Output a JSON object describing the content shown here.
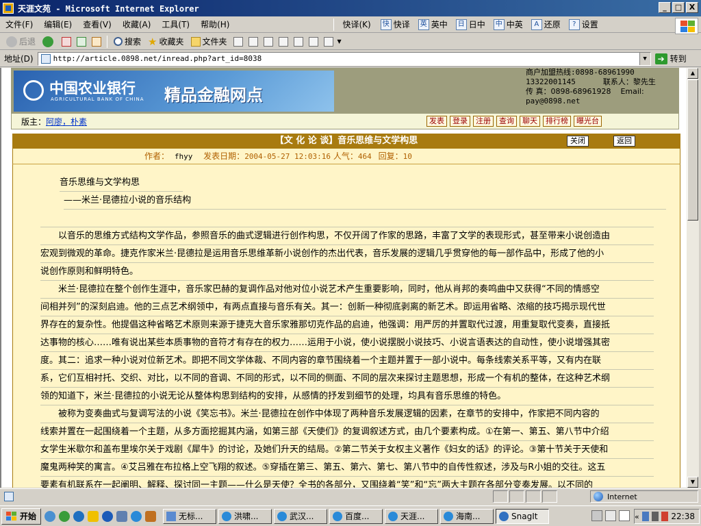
{
  "window": {
    "title": "天涯文苑 - Microsoft Internet Explorer",
    "buttons": {
      "minimize": "_",
      "maximize": "□",
      "close": "X"
    }
  },
  "menu": {
    "items": [
      "文件(F)",
      "编辑(E)",
      "查看(V)",
      "收藏(A)",
      "工具(T)",
      "帮助(H)"
    ],
    "quick_label": "快译(K)",
    "quick_items": [
      {
        "icon": "快",
        "label": "快译"
      },
      {
        "icon": "英",
        "label": "英中"
      },
      {
        "icon": "日",
        "label": "日中"
      },
      {
        "icon": "中",
        "label": "中英"
      },
      {
        "icon": "A",
        "label": "还原"
      },
      {
        "icon": "?",
        "label": "设置"
      }
    ]
  },
  "toolbar": {
    "back": "后退",
    "search": "搜索",
    "favorites": "收藏夹",
    "folders": "文件夹"
  },
  "address": {
    "label": "地址(D)",
    "url": "http://article.0898.net/inread.php?art_id=8038",
    "go": "转到"
  },
  "page": {
    "banner": {
      "bank_cn": "中国农业银行",
      "bank_en": "AGRICULTURAL BANK OF CHINA",
      "slogan": "精品金融网点"
    },
    "contact": {
      "hotline": "商户加盟热线:0898-68961990",
      "phone": "13322001145",
      "contact_person": "联系人：黎先生",
      "fax": "传  真：0898-68961928",
      "email_label": "Email:",
      "email": "pay@0898.net"
    },
    "nav": {
      "moderator_label": "版主：",
      "moderators": "阿廖，朴素",
      "buttons": [
        "发表",
        "登录",
        "注册",
        "查询",
        "聊天",
        "排行榜",
        "曝光台"
      ]
    },
    "article": {
      "title": "【文 化 论 谈】音乐思维与文学构思",
      "close_btn": "关闭",
      "back_btn": "返回",
      "author_label": "作者：",
      "author": "fhyy",
      "date_label": "发表日期：",
      "date": "2004-05-27 12:03:16",
      "views_label": "人气：",
      "views": "464",
      "replies_label": "回复：",
      "replies": "10",
      "lines": [
        "音乐思维与文学构思",
        "——米兰·昆德拉小说的音乐结构",
        "",
        "以音乐的思维方式结构文学作品，参照音乐的曲式逻辑进行创作构思，不仅开阔了作家的思路，丰富了文学的表现形式，甚至带来小说创造由",
        "宏观到微观的革命。捷克作家米兰·昆德拉是运用音乐思维革新小说创作的杰出代表，音乐发展的逻辑几乎贯穿他的每一部作品中，形成了他的小",
        "说创作原则和鲜明特色。",
        "米兰·昆德拉在整个创作生涯中，音乐家巴赫的复调作品对他对位小说艺术产生重要影响，同时，他从肖邦的奏鸣曲中又获得“不同的情感空",
        "间相并列”的深刻启迪。他的三点艺术纲领中，有两点直接与音乐有关。其一：创新一种彻底剥离的新艺术。即运用省略、浓缩的技巧揭示现代世",
        "界存在的复杂性。他提倡这种省略艺术原则来源于捷克大音乐家雅那切克作品的启迪，他强调：用严厉的并置取代过渡，用重复取代变奏，直接抵",
        "达事物的核心……唯有说出某些本质事物的音符才有存在的权力……运用于小说，使小说摆脱小说技巧、小说言语表达的自动性，使小说增强其密",
        "度。其二：追求一种小说对位新艺术。即把不同文学体裁、不同内容的章节围绕着一个主题并置于一部小说中。每条线索关系平等，又有内在联",
        "系，它们互相衬托、交织、对比，以不同的音调、不同的形式，以不同的侧面、不同的层次来探讨主题思想，形成一个有机的整体，在这种艺术纲",
        "领的知道下，米兰·昆德拉的小说无论从整体构思到结构的安排，从感情的抒发到细节的处理，均具有音乐思维的特色。",
        "被称为变奏曲式与复调写法的小说《笑忘书》。米兰·昆德拉在创作中体现了两种音乐发展逻辑的因素，在章节的安排中，作家把不同内容的",
        "线索并置在一起围绕着一个主题，从多方面挖掘其内涵，如第三部《天使们》的复调叙述方式，由几个要素构成。①在第一、第五、第八节中介绍",
        "女学生米歇尔和盖布里埃尔关于戏剧《犀牛》的讨论，及她们升天的结局。②第二节关于女权主义著作《妇女的话》的评论。③第十节关于天使和",
        "魔鬼两种笑的寓言。④艾吕雅在布拉格上空飞翔的叙述。⑤穿插在第三、第五、第六、第七、第八节中的自传性叙述，涉及与R小姐的交往。这五",
        "要素有机联系在一起阐明、解释、探讨同一主题——什么是天使？全书的各部分，又围绕着“笑”和“忘”两大主题在各部分变奏发展。以不同的"
      ]
    }
  },
  "statusbar": {
    "zone": "Internet"
  },
  "taskbar": {
    "start": "开始",
    "tasks": [
      "无标...",
      "洪啸...",
      "武汉...",
      "百度...",
      "天涯...",
      "海南...",
      "SnagIt"
    ],
    "active_task": 6,
    "clock": "22:38"
  }
}
